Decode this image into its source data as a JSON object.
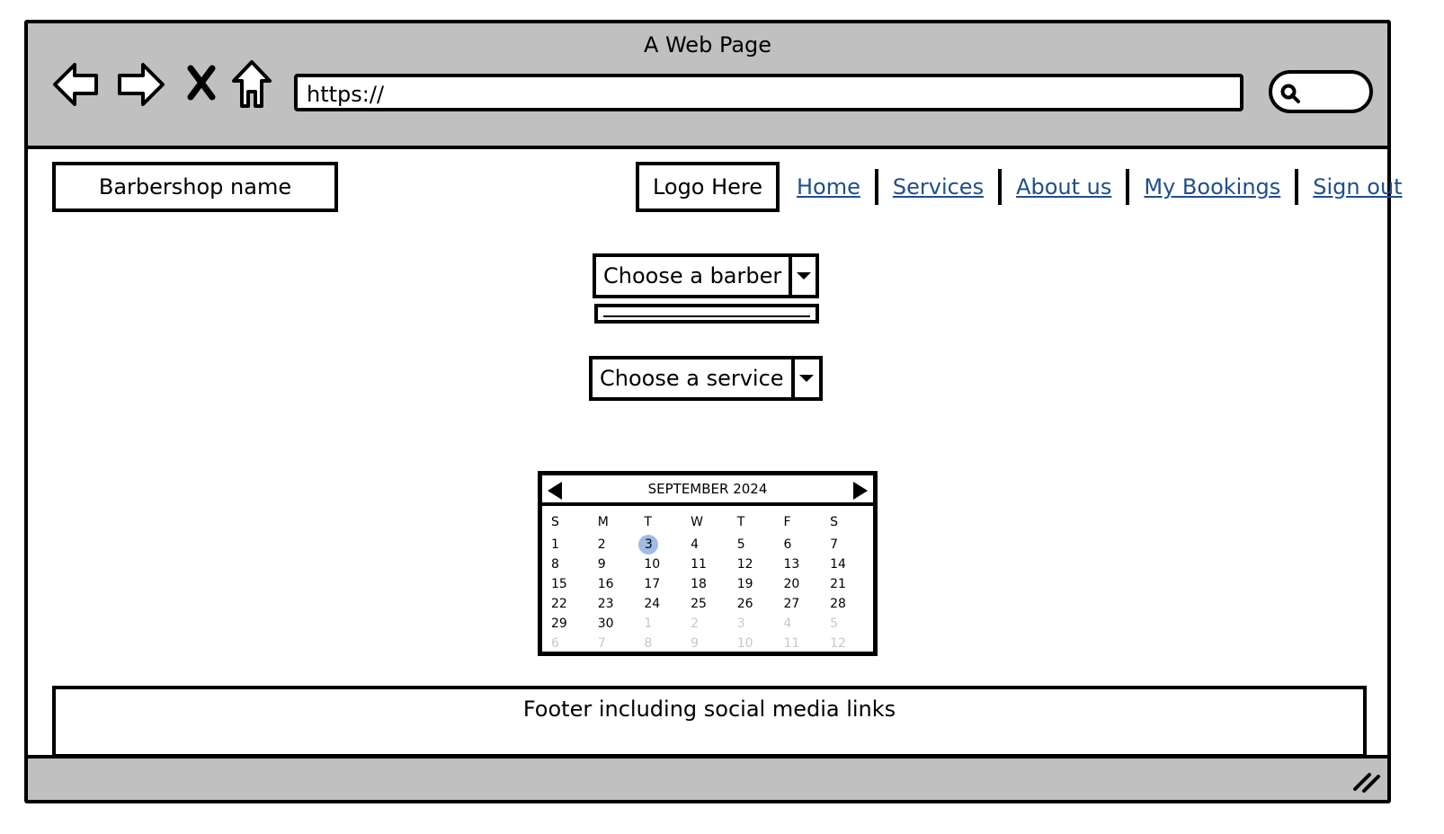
{
  "window": {
    "title": "A Web Page"
  },
  "browser": {
    "url": "https://"
  },
  "header": {
    "brand": "Barbershop name",
    "logo": "Logo Here",
    "nav": [
      "Home",
      "Services",
      "About us",
      "My Bookings",
      "Sign out"
    ],
    "link_color": "#1f4e8c"
  },
  "form": {
    "barber_select": "Choose a barber",
    "service_select": "Choose a service"
  },
  "calendar": {
    "month_label": "SEPTEMBER 2024",
    "weekdays": [
      "S",
      "M",
      "T",
      "W",
      "T",
      "F",
      "S"
    ],
    "weeks": [
      [
        "1",
        "2",
        "3",
        "4",
        "5",
        "6",
        "7"
      ],
      [
        "8",
        "9",
        "10",
        "11",
        "12",
        "13",
        "14"
      ],
      [
        "15",
        "16",
        "17",
        "18",
        "19",
        "20",
        "21"
      ],
      [
        "22",
        "23",
        "24",
        "25",
        "26",
        "27",
        "28"
      ],
      [
        "29",
        "30",
        "1",
        "2",
        "3",
        "4",
        "5"
      ],
      [
        "6",
        "7",
        "8",
        "9",
        "10",
        "11",
        "12"
      ]
    ],
    "selected_day": "3",
    "selected_color": "#9fbbe6"
  },
  "footer": {
    "text": "Footer including social media links"
  },
  "icons": [
    "back-arrow-icon",
    "forward-arrow-icon",
    "stop-icon",
    "home-icon",
    "search-icon",
    "resize-grip-icon"
  ]
}
